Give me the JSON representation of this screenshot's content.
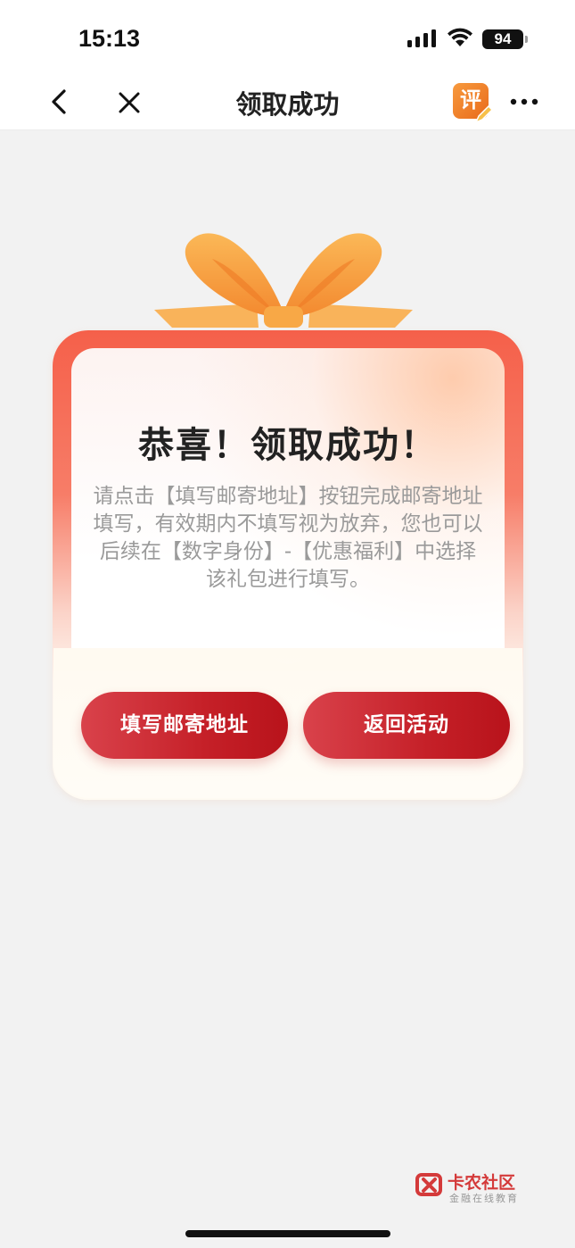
{
  "status_bar": {
    "time": "15:13",
    "battery": "94"
  },
  "nav": {
    "title": "领取成功",
    "review_badge": "评"
  },
  "card": {
    "title": "恭喜！领取成功！",
    "description": "请点击【填写邮寄地址】按钮完成邮寄地址填写，有效期内不填写视为放弃，您也可以后续在【数字身份】-【优惠福利】中选择该礼包进行填写。",
    "buttons": {
      "fill_address": "填写邮寄地址",
      "return_activity": "返回活动"
    }
  },
  "watermark": {
    "title": "卡农社区",
    "subtitle": "金融在线教育"
  },
  "colors": {
    "primary_red": "#c52028",
    "ribbon_orange": "#f7a44a"
  }
}
